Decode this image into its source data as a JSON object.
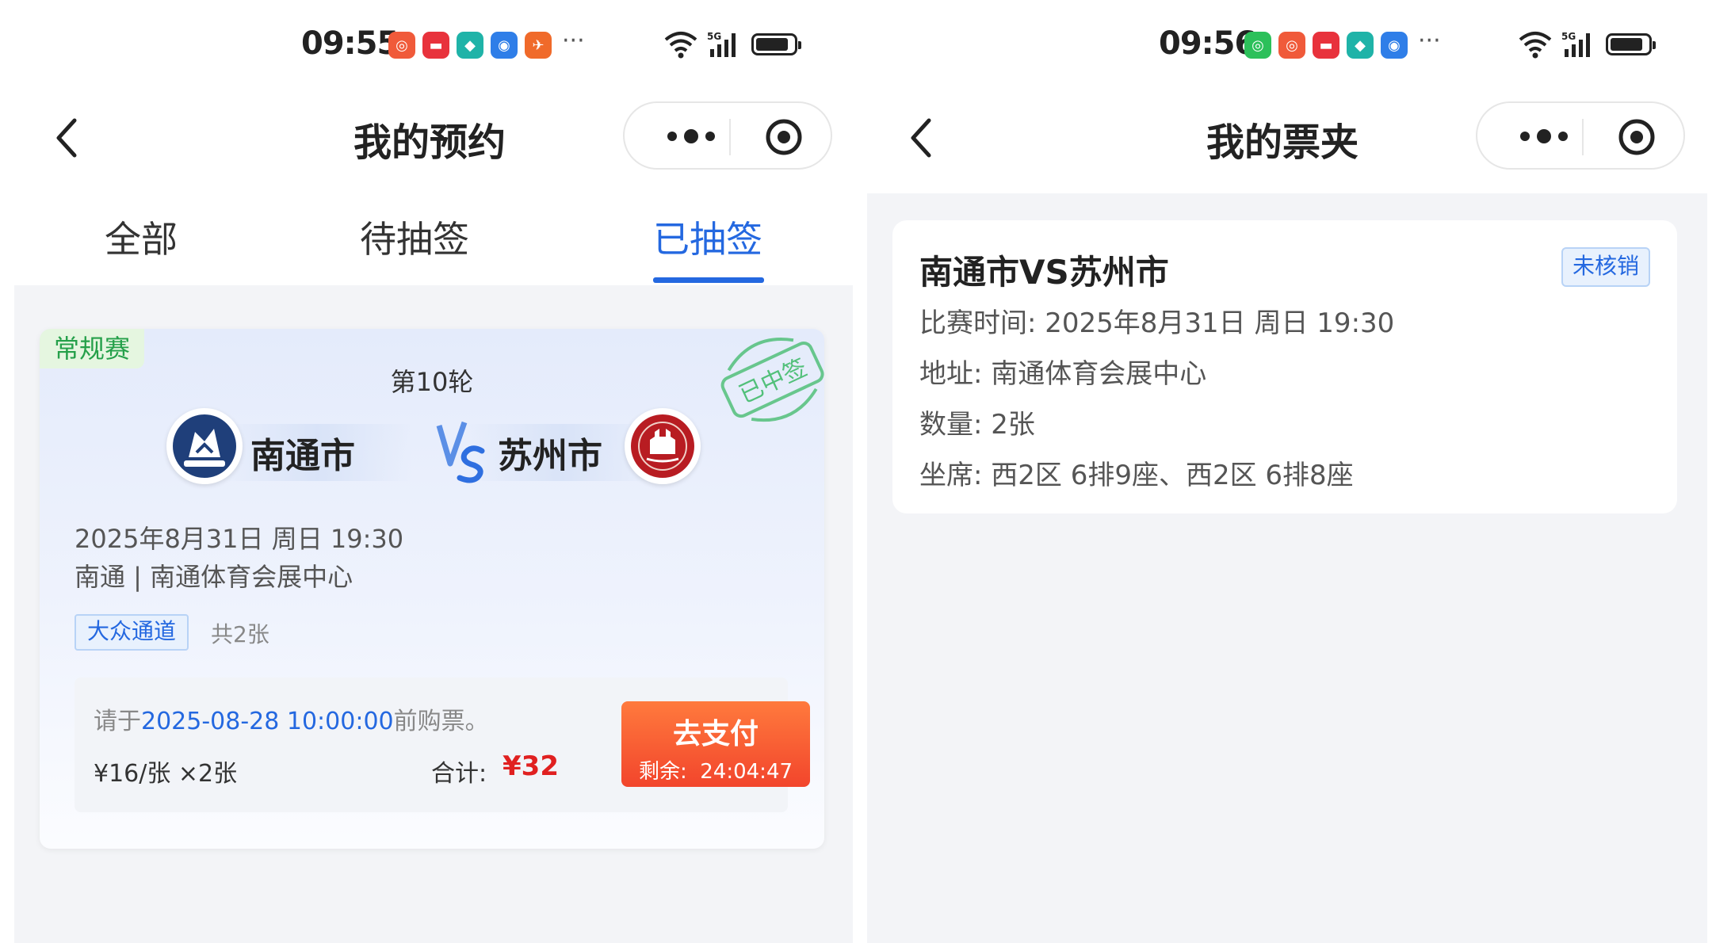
{
  "left": {
    "status": {
      "time": "09:55",
      "more": "···"
    },
    "nav": {
      "title": "我的预约"
    },
    "tabs": [
      {
        "label": "全部"
      },
      {
        "label": "待抽签"
      },
      {
        "label": "已抽签"
      }
    ],
    "active_tab": "已抽签",
    "card": {
      "tag": "常规赛",
      "round": "第10轮",
      "stamp": "已中签",
      "home": "南通市",
      "away": "苏州市",
      "datetime": "2025年8月31日 周日 19:30",
      "venue": "南通 | 南通体育会展中心",
      "channel": "大众通道",
      "total_tickets": "共2张",
      "pay_prefix": "请于",
      "pay_deadline": "2025-08-28 10:00:00",
      "pay_suffix": "前购票。",
      "unit_price": "¥16/张 ×2张",
      "sum_label": "合计:",
      "sum_value": "¥32",
      "pay_button": "去支付",
      "remaining_label": "剩余:",
      "remaining": "24:04:47"
    }
  },
  "right": {
    "status": {
      "time": "09:56",
      "more": "···"
    },
    "nav": {
      "title": "我的票夹"
    },
    "ticket": {
      "title": "南通市VS苏州市",
      "badge": "未核销",
      "time": "比赛时间: 2025年8月31日 周日 19:30",
      "address": "地址: 南通体育会展中心",
      "quantity": "数量: 2张",
      "seats": "坐席: 西2区 6排9座、西2区 6排8座"
    }
  },
  "colors": {
    "accent": "#2468e0",
    "price": "#e02020",
    "pay": "#f2452c",
    "green": "#25a04a"
  }
}
